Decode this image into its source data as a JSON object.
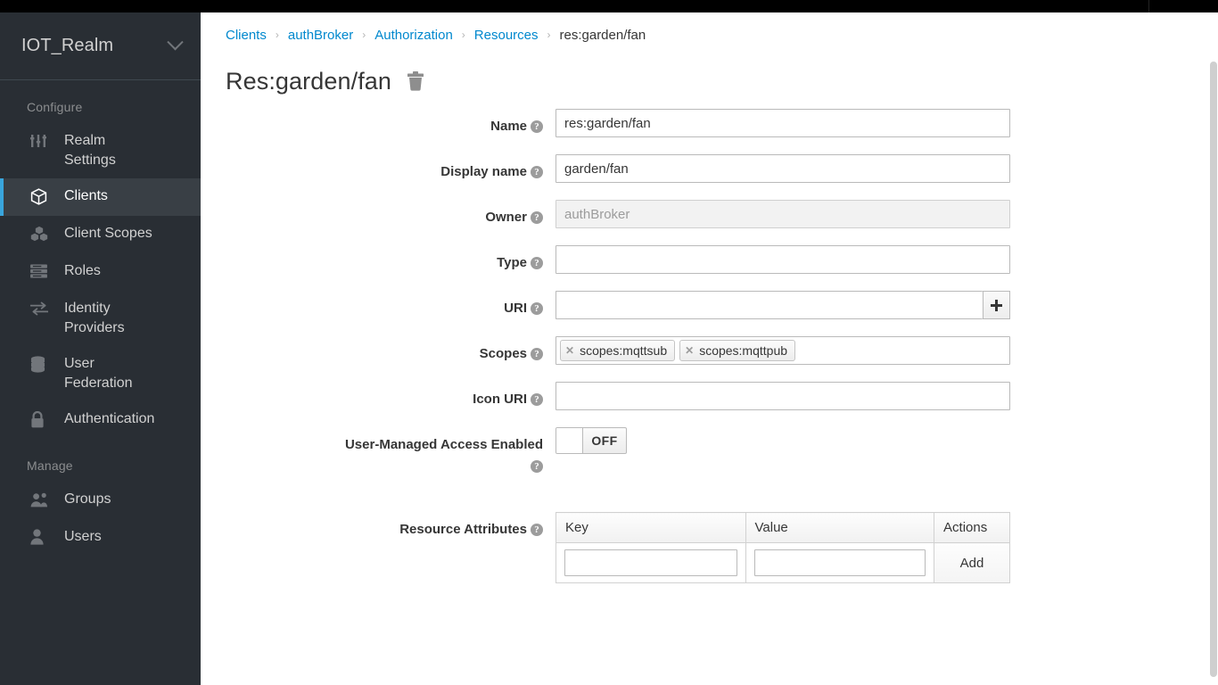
{
  "topbar": {
    "present": true
  },
  "sidebar": {
    "realm": {
      "name": "IOT_Realm",
      "chevron_icon": "chevron-down-icon"
    },
    "sections": [
      {
        "title": "Configure",
        "items": [
          {
            "label": "Realm\nSettings",
            "icon": "sliders-icon",
            "active": false
          },
          {
            "label": "Clients",
            "icon": "cube-icon",
            "active": true
          },
          {
            "label": "Client Scopes",
            "icon": "cubes-icon",
            "active": false
          },
          {
            "label": "Roles",
            "icon": "list-icon",
            "active": false
          },
          {
            "label": "Identity\nProviders",
            "icon": "exchange-icon",
            "active": false
          },
          {
            "label": "User\nFederation",
            "icon": "database-icon",
            "active": false
          },
          {
            "label": "Authentication",
            "icon": "lock-icon",
            "active": false
          }
        ]
      },
      {
        "title": "Manage",
        "items": [
          {
            "label": "Groups",
            "icon": "users-icon",
            "active": false
          },
          {
            "label": "Users",
            "icon": "user-icon",
            "active": false
          }
        ]
      }
    ]
  },
  "breadcrumb": {
    "items": [
      {
        "label": "Clients",
        "link": true
      },
      {
        "label": "authBroker",
        "link": true
      },
      {
        "label": "Authorization",
        "link": true
      },
      {
        "label": "Resources",
        "link": true
      },
      {
        "label": "res:garden/fan",
        "link": false
      }
    ],
    "separator": "›"
  },
  "page": {
    "title": "Res:garden/fan",
    "delete_icon": "trash-icon"
  },
  "form": {
    "help_glyph": "?",
    "fields": {
      "name": {
        "label": "Name",
        "value": "res:garden/fan",
        "placeholder": ""
      },
      "display_name": {
        "label": "Display name",
        "value": "garden/fan",
        "placeholder": ""
      },
      "owner": {
        "label": "Owner",
        "value": "",
        "placeholder": "authBroker",
        "disabled": true
      },
      "type": {
        "label": "Type",
        "value": "",
        "placeholder": ""
      },
      "uri": {
        "label": "URI",
        "value": "",
        "placeholder": "",
        "add_button_icon": "plus-icon"
      },
      "scopes": {
        "label": "Scopes",
        "chips": [
          "scopes:mqttsub",
          "scopes:mqttpub"
        ],
        "remove_icon": "close-icon"
      },
      "icon_uri": {
        "label": "Icon URI",
        "value": "",
        "placeholder": ""
      },
      "uma": {
        "label": "User-Managed Access Enabled",
        "state": "OFF",
        "on": false
      },
      "attributes": {
        "label": "Resource Attributes"
      }
    }
  },
  "attributes_table": {
    "headers": [
      "Key",
      "Value",
      "Actions"
    ],
    "rows": [
      {
        "key": "",
        "value": "",
        "action_label": "Add"
      }
    ]
  },
  "colors": {
    "link": "#0088ce",
    "sidebar_bg": "#292e34",
    "active_accent": "#39a5dc",
    "text": "#363636"
  }
}
